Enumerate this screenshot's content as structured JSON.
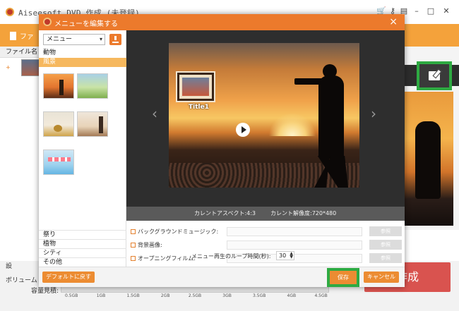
{
  "app": {
    "title": "Aiseesoft DVD 作成 (未登録)",
    "toolbar_file_label": "ファ",
    "list_header": "ファイル名",
    "expand_symbol": "+",
    "window_icons": [
      "cart-icon",
      "key-icon",
      "feedback-icon",
      "minimize-icon",
      "maximize-icon",
      "close-icon"
    ],
    "bottom_settings_label": "設",
    "bottom_volume_label": "ボリューム",
    "capacity_label": "容量見積:",
    "capacity_ticks": [
      "0.5GB",
      "1GB",
      "1.5GB",
      "2GB",
      "2.5GB",
      "3GB",
      "3.5GB",
      "4GB",
      "4.5GB"
    ],
    "create_button": "作成"
  },
  "dialog": {
    "title": "メニューを編集する",
    "close_symbol": "×",
    "menu_select_value": "メニュー",
    "categories_top": [
      "動物",
      "風景"
    ],
    "active_category": "風景",
    "categories_bottom": [
      "祭り",
      "植物",
      "シティ",
      "その他"
    ],
    "preview_title": "Title1",
    "aspect_text": "カレントアスペクト:4:3",
    "resolution_text": "カレント解像度:720*480",
    "options": [
      {
        "label": "バックグラウンドミュージック:",
        "browse": "参照"
      },
      {
        "label": "背景画像:",
        "browse": "参照"
      },
      {
        "label": "オープニングフィルム:",
        "browse": "参照"
      }
    ],
    "loop_label": "メニュー再生のループ時間(秒):",
    "loop_value": "30",
    "default_button": "デフォルトに戻す",
    "save_button": "保存",
    "cancel_button": "キャンセル"
  },
  "colors": {
    "accent_orange": "#ec7a2c",
    "highlight_green": "#2eaa42",
    "create_red": "#d9534f"
  }
}
